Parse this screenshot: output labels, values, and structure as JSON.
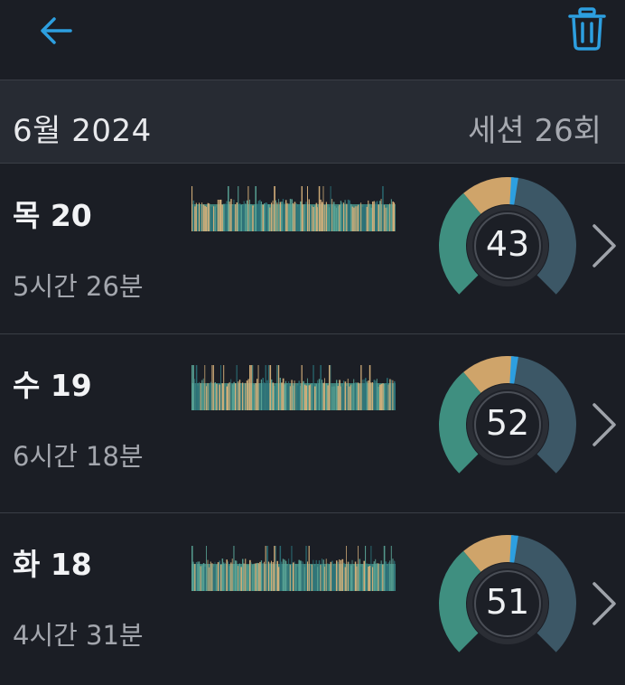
{
  "header": {
    "back_icon": "arrow-left-icon",
    "delete_icon": "trash-icon",
    "accent": "#2d9fe0"
  },
  "month": {
    "title": "6월 2024",
    "sessions": "세션 26회"
  },
  "colors": {
    "teal": "#3f8f80",
    "tan": "#cfa46a",
    "slate": "#3c5766",
    "pointer": "#2d9fe0",
    "strip_light": "#d6b07a",
    "strip_dark": "#2a6f78"
  },
  "sessions": [
    {
      "day": "목 20",
      "duration": "5시간 26분",
      "score": "43",
      "score_value": 43,
      "seed": 11
    },
    {
      "day": "수 19",
      "duration": "6시간 18분",
      "score": "52",
      "score_value": 52,
      "seed": 29
    },
    {
      "day": "화 18",
      "duration": "4시간 31분",
      "score": "51",
      "score_value": 51,
      "seed": 47
    }
  ]
}
